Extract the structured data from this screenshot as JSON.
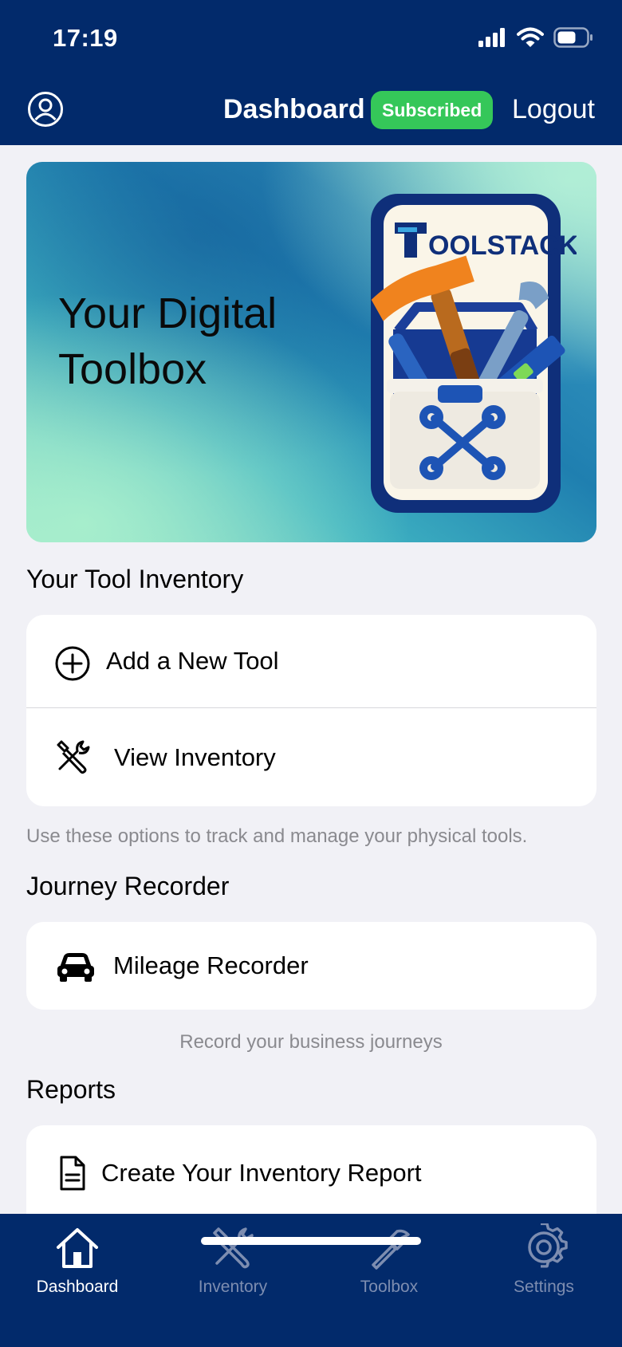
{
  "status": {
    "time": "17:19"
  },
  "header": {
    "title": "Dashboard",
    "badge": "Subscribed",
    "logout": "Logout"
  },
  "hero": {
    "title": "Your Digital Toolbox",
    "brand": "OOLSTACK"
  },
  "inventory": {
    "title": "Your Tool Inventory",
    "items": [
      {
        "label": "Add a New Tool"
      },
      {
        "label": "View Inventory"
      }
    ],
    "hint": "Use these options to track and manage your physical tools."
  },
  "journey": {
    "title": "Journey Recorder",
    "items": [
      {
        "label": "Mileage Recorder"
      }
    ],
    "hint": "Record your business journeys"
  },
  "reports": {
    "title": "Reports",
    "items": [
      {
        "label": "Create Your Inventory Report"
      }
    ]
  },
  "tabs": [
    {
      "label": "Dashboard",
      "icon": "house-icon",
      "active": true
    },
    {
      "label": "Inventory",
      "icon": "tools-icon",
      "active": false
    },
    {
      "label": "Toolbox",
      "icon": "hammer-icon",
      "active": false
    },
    {
      "label": "Settings",
      "icon": "gear-icon",
      "active": false
    }
  ],
  "colors": {
    "navy": "#022a6b",
    "badge_green": "#35c759",
    "background": "#f1f1f6"
  }
}
